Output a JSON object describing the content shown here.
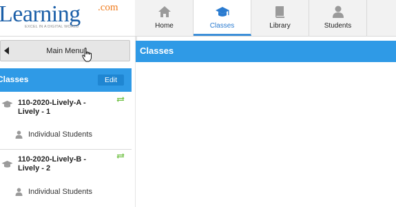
{
  "logo": {
    "main": "Learning",
    "suffix": ".com",
    "tagline": "EXCEL IN A DIGITAL WORLD"
  },
  "nav": {
    "tabs": [
      {
        "label": "Home",
        "icon": "home-icon",
        "active": false
      },
      {
        "label": "Classes",
        "icon": "graduation-cap-icon",
        "active": true
      },
      {
        "label": "Library",
        "icon": "book-icon",
        "active": false
      },
      {
        "label": "Students",
        "icon": "person-icon",
        "active": false
      }
    ]
  },
  "sidebar": {
    "main_menu_label": "Main Menu",
    "section_title": "Classes",
    "edit_label": "Edit",
    "classes": [
      {
        "name": "110-2020-Lively-A - Lively - 1",
        "sub_label": "Individual Students"
      },
      {
        "name": "110-2020-Lively-B - Lively - 2",
        "sub_label": "Individual Students"
      }
    ]
  },
  "main": {
    "title": "Classes"
  },
  "colors": {
    "accent_blue": "#2f9ae6",
    "logo_blue": "#1b5fa8",
    "logo_orange": "#f07c1e",
    "sync_green": "#6cbf3f"
  }
}
